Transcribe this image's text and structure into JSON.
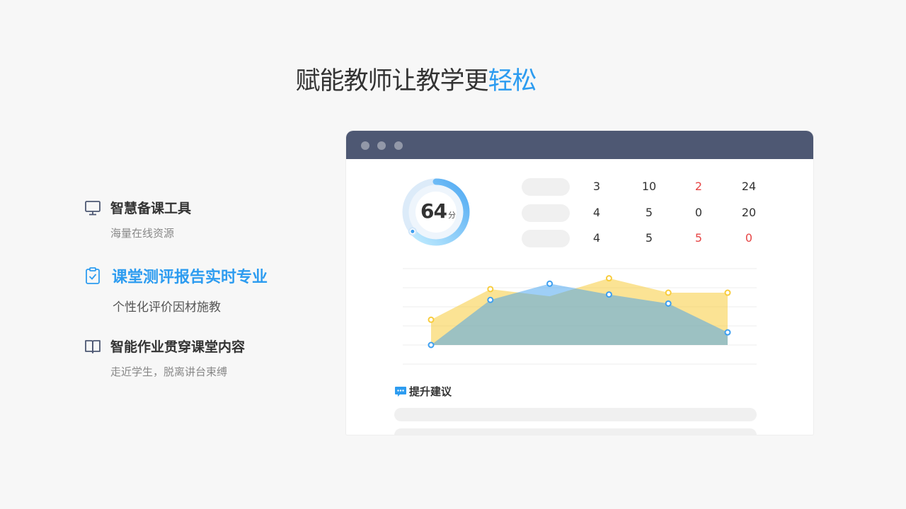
{
  "headline": {
    "main": "赋能教师让教学更",
    "accent": "轻松"
  },
  "features": [
    {
      "title": "智慧备课工具",
      "subtitle": "海量在线资源",
      "icon": "monitor-icon"
    },
    {
      "title": "课堂测评报告实时专业",
      "subtitle": "个性化评价因材施教",
      "icon": "clipboard-check-icon"
    },
    {
      "title": "智能作业贯穿课堂内容",
      "subtitle": "走近学生，脱离讲台束缚",
      "icon": "book-icon"
    }
  ],
  "report": {
    "score": {
      "value": "64",
      "unit": "分",
      "progress": 0.64
    },
    "stats": [
      [
        "3",
        "10",
        "2",
        "24"
      ],
      [
        "4",
        "5",
        "0",
        "20"
      ],
      [
        "4",
        "5",
        "5",
        "0"
      ]
    ],
    "suggestion_label": "提升建议"
  },
  "chart_data": {
    "type": "area",
    "categories": [
      "",
      "",
      "",
      "",
      "",
      ""
    ],
    "series": [
      {
        "values": [
          1.4,
          3.1,
          null,
          3.7,
          2.9,
          2.9
        ],
        "color": "#f8cc3c"
      },
      {
        "values": [
          0.0,
          2.5,
          3.4,
          2.8,
          2.3,
          0.7
        ],
        "color": "#3d9ff0"
      }
    ],
    "ylim": [
      0,
      4
    ],
    "grid": true
  },
  "colors": {
    "accent": "#2d9cf0",
    "titlebar": "#4e5873",
    "red": "#e64646"
  }
}
